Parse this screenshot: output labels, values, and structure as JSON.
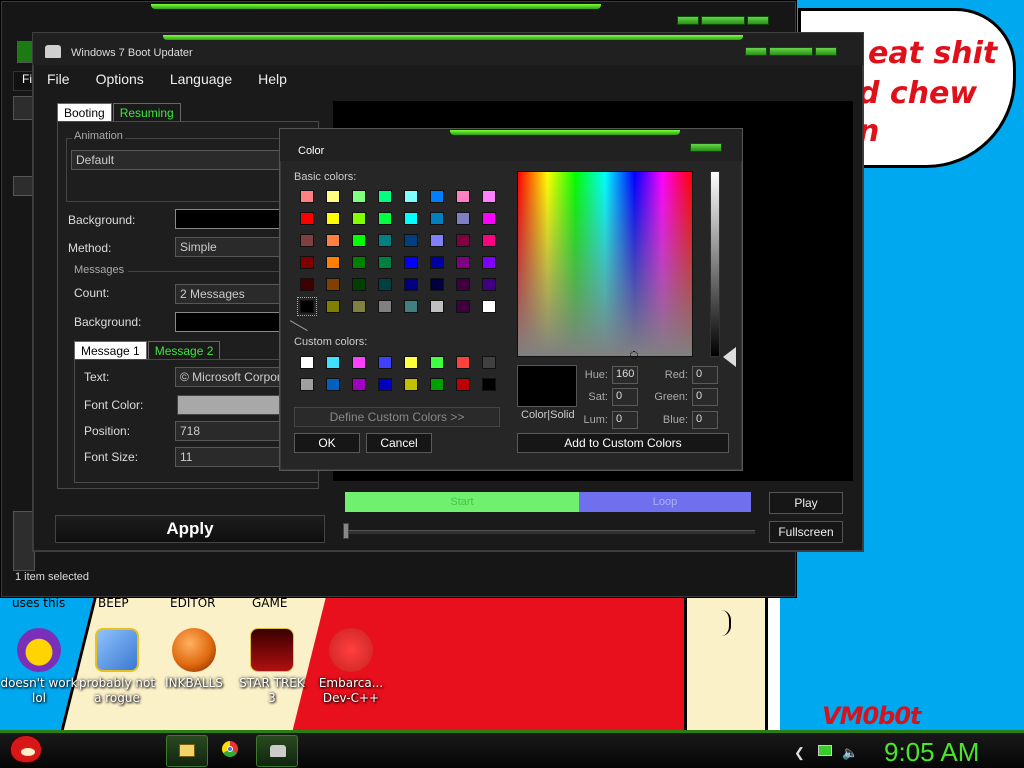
{
  "wallpaper": {
    "bubble_lines": [
      "eat shit",
      "d chew",
      "n"
    ],
    "signature": "VM0b0t"
  },
  "explorer": {
    "status": "1 item selected"
  },
  "boot_updater": {
    "title": "Windows 7 Boot Updater",
    "menu": [
      "File",
      "Options",
      "Language",
      "Help"
    ],
    "tabs": {
      "booting": "Booting",
      "resuming": "Resuming"
    },
    "animation": {
      "group": "Animation",
      "value": "Default"
    },
    "background_label": "Background:",
    "method_label": "Method:",
    "method_value": "Simple",
    "messages": {
      "group": "Messages",
      "count_label": "Count:",
      "count_value": "2 Messages",
      "background_label": "Background:",
      "tabs": [
        "Message 1",
        "Message 2"
      ],
      "text_label": "Text:",
      "text_value": "© Microsoft Corporation",
      "font_color_label": "Font Color:",
      "position_label": "Position:",
      "position_value": "718",
      "font_size_label": "Font Size:",
      "font_size_value": "11"
    },
    "apply": "Apply",
    "progress": {
      "start": "Start",
      "loop": "Loop"
    },
    "play": "Play",
    "fullscreen": "Fullscreen"
  },
  "color_dialog": {
    "title": "Color",
    "basic_label": "Basic colors:",
    "custom_label": "Custom colors:",
    "basic_colors": [
      [
        "#ff8080",
        "#ffff80",
        "#80ff80",
        "#00ff80",
        "#80ffff",
        "#0080ff",
        "#ff80c0",
        "#ff80ff"
      ],
      [
        "#ff0000",
        "#ffff00",
        "#80ff00",
        "#00ff40",
        "#00ffff",
        "#0080c0",
        "#8080c0",
        "#ff00ff"
      ],
      [
        "#804040",
        "#ff8040",
        "#00ff00",
        "#008080",
        "#004080",
        "#8080ff",
        "#800040",
        "#ff0080"
      ],
      [
        "#800000",
        "#ff8000",
        "#008000",
        "#008040",
        "#0000ff",
        "#0000a0",
        "#800080",
        "#8000ff"
      ],
      [
        "#400000",
        "#804000",
        "#004000",
        "#004040",
        "#000080",
        "#000040",
        "#400040",
        "#400080"
      ],
      [
        "#000000",
        "#808000",
        "#808040",
        "#808080",
        "#408080",
        "#c0c0c0",
        "#400040",
        "#ffffff"
      ]
    ],
    "custom_colors": [
      [
        "#ffffff",
        "#40e0ff",
        "#ff40ff",
        "#4040ff",
        "#ffff40",
        "#40ff40",
        "#ff4040",
        "#404040"
      ],
      [
        "#a0a0a0",
        "#0060c0",
        "#a000c0",
        "#0000c0",
        "#c0c000",
        "#00a000",
        "#c00000",
        "#000000"
      ]
    ],
    "selected_basic": "#000000",
    "color_solid_label": "Color|Solid",
    "hue_label": "Hue:",
    "hue": "160",
    "sat_label": "Sat:",
    "sat": "0",
    "lum_label": "Lum:",
    "lum": "0",
    "red_label": "Red:",
    "red": "0",
    "green_label": "Green:",
    "green": "0",
    "blue_label": "Blue:",
    "blue": "0",
    "define_custom": "Define Custom Colors >>",
    "ok": "OK",
    "cancel": "Cancel",
    "add_custom": "Add to Custom Colors"
  },
  "desktop": {
    "cut_labels": [
      "uses this",
      "BEEP",
      "EDITOR",
      "GAME"
    ],
    "icons": [
      {
        "line1": "doesn't work",
        "line2": "lol",
        "icon": "yahoo-messenger-icon",
        "color": "#7a2fb8"
      },
      {
        "line1": "probably not",
        "line2": "a rogue",
        "icon": "gears-program-icon",
        "color": "#3a78d0"
      },
      {
        "line1": "INKBALLS",
        "line2": "",
        "icon": "inkball-icon",
        "color": "#e06a10"
      },
      {
        "line1": "STAR TREK",
        "line2": "3",
        "icon": "star-wars-game-icon",
        "color": "#b01010"
      },
      {
        "line1": "Embarca...",
        "line2": "Dev-C++",
        "icon": "dev-cpp-icon",
        "color": "#c82020"
      }
    ]
  },
  "taskbar": {
    "clock": "9:05 AM"
  }
}
